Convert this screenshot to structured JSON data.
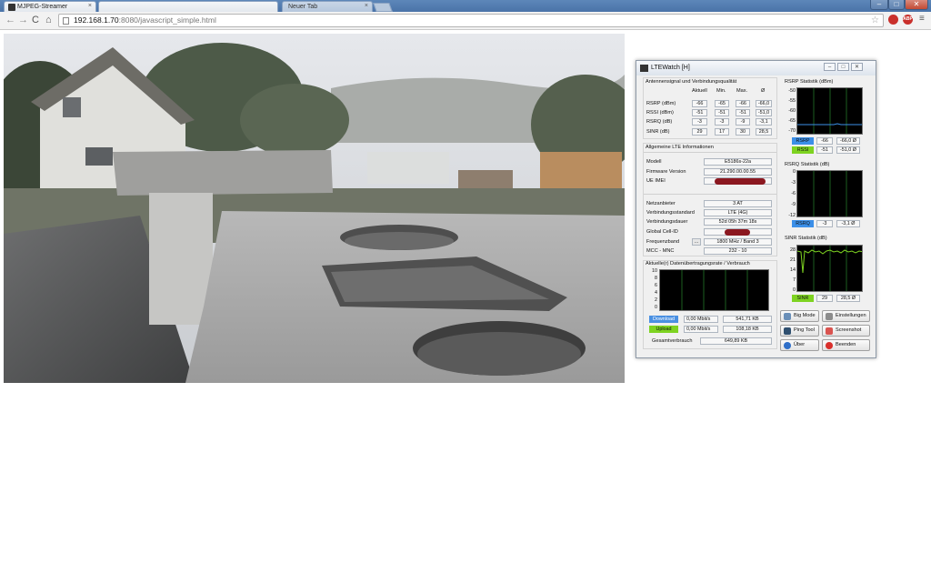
{
  "browser": {
    "tabs": [
      {
        "title": "MJPEG-Streamer",
        "close": "×"
      },
      {
        "title": "Neuer Tab",
        "close": "×"
      }
    ],
    "url_host": "192.168.1.70",
    "url_rest": ":8080/javascript_simple.html",
    "window_controls": {
      "minimize": "–",
      "maximize": "□",
      "close": "✕"
    },
    "extensions": [
      {
        "name": "opera-extension-icon",
        "label": "",
        "color": "#c9302c"
      },
      {
        "name": "adblock-extension-icon",
        "label": "ABP",
        "color": "#c9302c"
      }
    ]
  },
  "ltewatch": {
    "title": "LTEWatch [H]",
    "signal": {
      "title": "Antennensignal und Verbindungsqualität",
      "columns": [
        "Aktuell",
        "Min.",
        "Max.",
        "Ø"
      ],
      "rows": [
        {
          "label": "RSRP (dBm)",
          "values": [
            "-66",
            "-65",
            "-66",
            "-66,0"
          ]
        },
        {
          "label": "RSSI (dBm)",
          "values": [
            "-51",
            "-51",
            "-51",
            "-51,0"
          ]
        },
        {
          "label": "RSRQ (dB)",
          "values": [
            "-3",
            "-3",
            "-9",
            "-3,1"
          ]
        },
        {
          "label": "SINR (dB)",
          "values": [
            "29",
            "17",
            "30",
            "28,5"
          ]
        }
      ]
    },
    "info": {
      "title": "Allgemeine LTE Informationen",
      "rows": [
        {
          "label": "Modell",
          "value": "E5186s-22a"
        },
        {
          "label": "Firmware Version",
          "value": "21.290.00.00.55"
        },
        {
          "label": "UE IMEI",
          "value": ""
        },
        {
          "label": "Netzanbieter",
          "value": "3 AT"
        },
        {
          "label": "Verbindungsstandard",
          "value": "LTE (4G)"
        },
        {
          "label": "Verbindungsdauer",
          "value": "52d 05h 37m 18s"
        },
        {
          "label": "Global Cell-ID",
          "value": ""
        },
        {
          "label": "Frequenzband",
          "value": "1800 MHz / Band 3"
        },
        {
          "label": "MCC - MNC",
          "value": "232 - 10"
        }
      ],
      "band_button": "..."
    },
    "traffic": {
      "title": "Aktuelle(r) Datenübertragungsrate / Verbrauch",
      "ticks": [
        "10",
        "8",
        "6",
        "4",
        "2",
        "0"
      ],
      "download": {
        "label": "Download",
        "rate": "0,00 Mbit/s",
        "total": "541,71 KB",
        "color": "#4a90e2"
      },
      "upload": {
        "label": "Upload",
        "rate": "0,00 Mbit/s",
        "total": "108,18 KB",
        "color": "#7ed321"
      },
      "usage_label": "Gesamtverbrauch",
      "usage_value": "649,89 KB"
    },
    "rsrp_stat": {
      "title": "RSRP Statistik (dBm)",
      "ticks": [
        "-50",
        "-55",
        "-60",
        "-65",
        "-70"
      ],
      "legend": [
        {
          "label": "RSRP",
          "current": "-66",
          "avg": "-66,0 Ø",
          "color": "#3b8fe8"
        },
        {
          "label": "RSSI",
          "current": "-51",
          "avg": "-51,0 Ø",
          "color": "#7ed321"
        }
      ]
    },
    "rsrq_stat": {
      "title": "RSRQ Statistik (dB)",
      "ticks": [
        "0",
        "-3",
        "-6",
        "-9",
        "-12"
      ],
      "legend": [
        {
          "label": "RSRQ",
          "current": "-3",
          "avg": "-3,1 Ø",
          "color": "#3b8fe8"
        }
      ]
    },
    "sinr_stat": {
      "title": "SINR Statistik (dB)",
      "ticks": [
        "28",
        "21",
        "14",
        "7",
        "0"
      ],
      "legend": [
        {
          "label": "SINR",
          "current": "29",
          "avg": "28,5 Ø",
          "color": "#7ed321"
        }
      ]
    },
    "buttons": [
      {
        "label": "Big Mode",
        "icon": "magnifier-icon",
        "color": "#6a8fb8"
      },
      {
        "label": "Einstellungen",
        "icon": "settings-icon",
        "color": "#8c8c8c"
      },
      {
        "label": "Ping Tool",
        "icon": "ping-icon",
        "color": "#2f4f6f"
      },
      {
        "label": "Screenshot",
        "icon": "screenshot-icon",
        "color": "#d9534f"
      },
      {
        "label": "Über",
        "icon": "info-icon",
        "color": "#2f6fc9"
      },
      {
        "label": "Beenden",
        "icon": "exit-icon",
        "color": "#d9302c"
      }
    ]
  }
}
